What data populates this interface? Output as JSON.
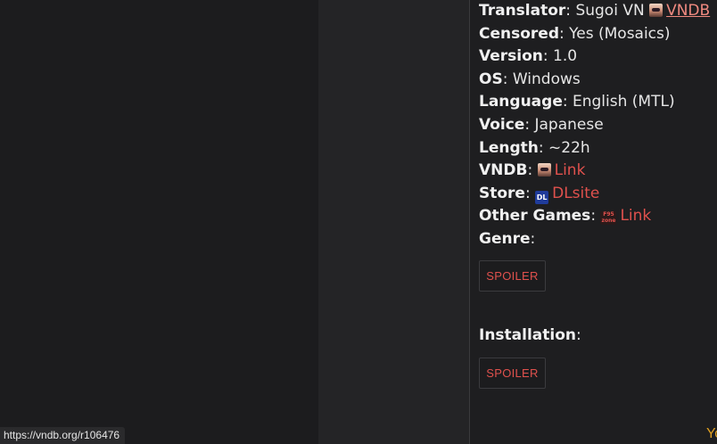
{
  "info": {
    "translator": {
      "label": "Translator",
      "value": "Sugoi VN",
      "link": "VNDB"
    },
    "censored": {
      "label": "Censored",
      "value": "Yes (Mosaics)"
    },
    "version": {
      "label": "Version",
      "value": "1.0"
    },
    "os": {
      "label": "OS",
      "value": "Windows"
    },
    "language": {
      "label": "Language",
      "value": "English (MTL)"
    },
    "voice": {
      "label": "Voice",
      "value": "Japanese"
    },
    "length": {
      "label": "Length",
      "value": "~22h"
    },
    "vndb": {
      "label": "VNDB",
      "link": "Link"
    },
    "store": {
      "label": "Store",
      "link": "DLsite"
    },
    "other_games": {
      "label": "Other Games",
      "link": "Link"
    },
    "genre": {
      "label": "Genre"
    }
  },
  "spoiler_label": "SPOILER",
  "installation": {
    "label": "Installation"
  },
  "status_bar": {
    "url": "https://vndb.org/r106476"
  },
  "corner_text": "Yo",
  "icons": [
    "vndb-icon",
    "dlsite-icon",
    "f95-icon"
  ],
  "colors": {
    "link": "#e0514d",
    "visited_link": "#f08a80",
    "background": "#1e1e20"
  }
}
